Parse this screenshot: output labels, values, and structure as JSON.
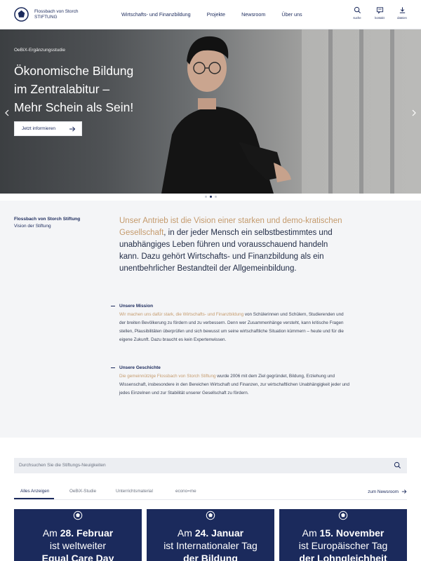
{
  "header": {
    "logo_line1": "Flossbach von Storch",
    "logo_line2": "STIFTUNG",
    "nav": [
      "Wirtschafts- und Finanzbildung",
      "Projekte",
      "Newsroom",
      "Über uns"
    ],
    "tools": [
      {
        "label": "suche",
        "icon": "search-icon"
      },
      {
        "label": "kontakt",
        "icon": "message-icon"
      },
      {
        "label": "dateien",
        "icon": "download-icon"
      }
    ]
  },
  "hero": {
    "tag": "OeBiX-Ergänzungsstudie",
    "title_lines": [
      "Ökonomische Bildung",
      "im Zentralabitur –",
      "Mehr Schein als Sein!"
    ],
    "button_label": "Jetzt informieren",
    "slide_count": 3,
    "active_slide": 2
  },
  "vision": {
    "org": "Flossbach von Storch Stiftung",
    "org_sub": "Vision der Stiftung",
    "lead_accent": "Unser Antrieb ist die Vision einer starken und demo-kratischen Gesellschaft",
    "lead_rest": ", in der jeder Mensch ein selbstbestimmtes und unabhängiges Leben führen und vorausschauend handeln kann. Dazu gehört Wirtschafts- und Finanzbildung als ein unentbehrlicher Bestandteil der Allgemeinbildung.",
    "mission_title": "Unsere Mission",
    "mission_accent": "Wir machen uns dafür stark, die Wirtschafts- und Finanzbildung",
    "mission_rest": " von Schülerinnen und Schülern, Studierenden und der breiten Bevölkerung zu fördern und zu verbessern. Denn wer Zusammenhänge versteht, kann kritische Fragen stellen, Plausibilitäten überprüfen und sich bewusst um seine wirtschaftliche Situation kümmern – heute und für die eigene Zukunft. Dazu braucht es kein Expertenwissen.",
    "history_title": "Unsere Geschichte",
    "history_accent": "Die gemeinnützige Flossbach von Storch Stiftung",
    "history_rest": " wurde 2006 mit dem Ziel gegründet, Bildung, Erziehung und Wissenschaft, insbesondere in den Bereichen Wirtschaft und Finanzen, zur wirtschaftlichen Unabhängigkeit jeder und jedes Einzelnen und zur Stabilität unserer Gesellschaft zu fördern."
  },
  "news": {
    "search_placeholder": "Durchsuchen Sie die Stiftungs-Neuigkeiten",
    "tabs": [
      "Alles Anzeigen",
      "OeBiX-Studie",
      "Unterrichtsmaterial",
      "econo=me"
    ],
    "newsroom_link": "zum Newsroom",
    "cards": [
      {
        "prefix": "Am ",
        "date": "28. Februar",
        "line2": "ist weltweiter",
        "line3": "Equal Care Day"
      },
      {
        "prefix": "Am ",
        "date": "24. Januar",
        "line2": "ist Internationaler Tag",
        "line3": "der Bildung"
      },
      {
        "prefix": "Am ",
        "date": "15. November",
        "line2": "ist Europäischer Tag",
        "line3": "der Lohngleichheit"
      }
    ]
  },
  "colors": {
    "brand": "#1b2a5c",
    "accent": "#c49a6c",
    "section_bg": "#f4f5f7"
  }
}
